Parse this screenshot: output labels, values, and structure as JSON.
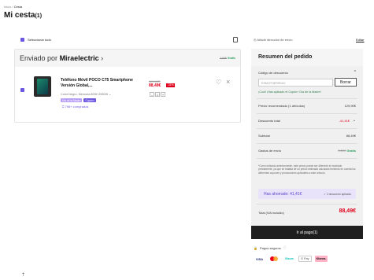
{
  "breadcrumb": {
    "home": "Inicio",
    "sep": " / ",
    "current": "Cesta"
  },
  "page": {
    "title": "Mi cesta",
    "count": "(1)"
  },
  "cart": {
    "select_all": "Seleccionar todo",
    "shipper_prefix": "Enviado por",
    "shipper_name": "Miraelectric",
    "shipper_arrow": "›",
    "shipping_old": "3,89€",
    "shipping_free": "Gratis",
    "item": {
      "name": "Teléfono Móvil POCO C75 Smartphone Versión Global,...",
      "variant": "Color:Negro, Memoria:8GB+256GB ⌄",
      "tag1": "Día de la Madre",
      "tag2": "Cupón×",
      "points": "798+ comprados",
      "old_price": "129,90€",
      "new_price": "88,49€",
      "discount": "-31%",
      "qty": "1",
      "minus": "–",
      "plus": "+"
    }
  },
  "address": {
    "label": "Añadir dirección de envío",
    "edit": "Editar"
  },
  "summary": {
    "title": "Resumen del pedido",
    "code_label": "Código de descuento",
    "code_value": "ESMOTHERSDAY",
    "remove": "Borrar",
    "applied": "¡Cool! ¡Has aplicado el Cupón> Día de la Madre!",
    "rec_price_label": "Precio recomendado (1 artículos)",
    "rec_price": "129,90€",
    "discount_label": "Descuento total",
    "discount": "-41,41€",
    "subtotal_label": "Subtotal",
    "subtotal": "88,49€",
    "shipping_label": "Gastos de envío",
    "shipping_old": "3,89€",
    "shipping_free": "Gratis",
    "note": "*Como indicado anteriormente, este precio puede ser diferente al mostrado previamente, ya que se trataba de un precio estimado calculado teniendo en cuenta los diferentes cupones y promociones aplicables a este artículo.",
    "saved": "Has ahorrado: 41,41€",
    "saved_detail": "✓ 2 descuento aplicado",
    "total_label": "Total (IVA incluido)",
    "total": "88,49€",
    "pay_button": "Ir al pago(1)"
  },
  "payments": {
    "secure": "Pagos seguros",
    "methods": [
      "VISA",
      "",
      "Bizum",
      "G Pay",
      "Klarna."
    ]
  },
  "colors": {
    "accent": "#6b56e0",
    "price": "#e0001b",
    "button": "#1f1f1f",
    "success": "#2a9d5c"
  }
}
